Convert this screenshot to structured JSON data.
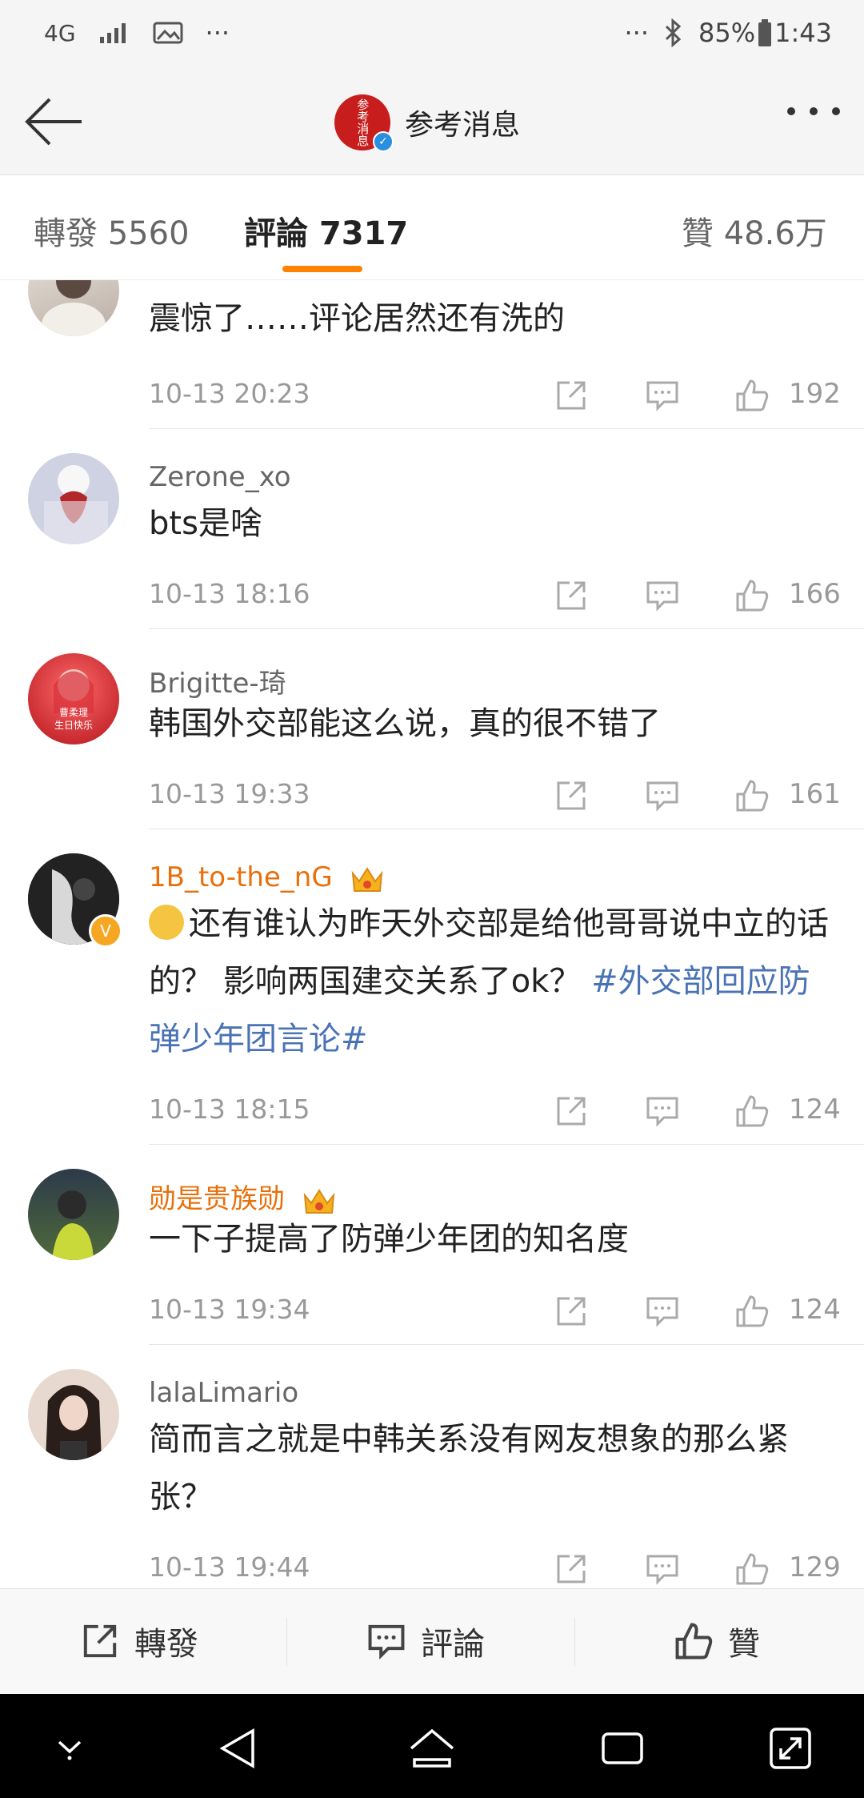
{
  "status_bar": {
    "network": "4G",
    "more": "···",
    "more_right": "···",
    "battery": "85%",
    "time": "1:43"
  },
  "nav": {
    "title": "参考消息",
    "logo_text": "参考消息"
  },
  "tabs": [
    {
      "label": "轉發",
      "count": "5560"
    },
    {
      "label": "評論",
      "count": "7317"
    },
    {
      "label": "贊",
      "count": "48.6万"
    }
  ],
  "comments": [
    {
      "username": "",
      "text": "震惊了……评论居然还有洗的",
      "time": "10-13 20:23",
      "likes": "192"
    },
    {
      "username": "Zerone_xo",
      "text": "bts是啥",
      "time": "10-13 18:16",
      "likes": "166"
    },
    {
      "username": "Brigitte-琦",
      "text": "韩国外交部能这么说，真的很不错了",
      "time": "10-13 19:33",
      "likes": "161",
      "avatar_text_1": "曹柔理",
      "avatar_text_2": "生日快乐"
    },
    {
      "username": "1B_to-the_nG",
      "text": "还有谁认为昨天外交部是给他哥哥说中立的话的？ 影响两国建交关系了ok？ ",
      "hashtag": "#外交部回应防弹少年团言论#",
      "time": "10-13 18:15",
      "likes": "124"
    },
    {
      "username": "勋是贵族勋",
      "text": "一下子提高了防弹少年团的知名度",
      "time": "10-13 19:34",
      "likes": "124"
    },
    {
      "username": "lalaLimario",
      "text": "简而言之就是中韩关系没有网友想象的那么紧张？",
      "time": "10-13 19:44",
      "likes": "129"
    }
  ],
  "bottom_bar": {
    "repost": "轉發",
    "comment": "評論",
    "like": "贊"
  },
  "colors": {
    "accent": "#ff8200",
    "vip_name": "#e8700a",
    "hashtag": "#4a73b5"
  }
}
